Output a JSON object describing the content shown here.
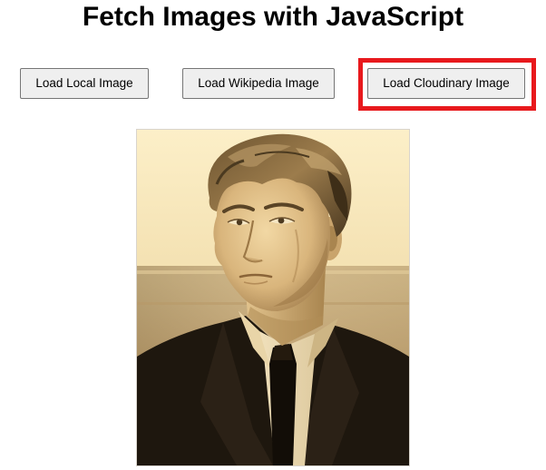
{
  "page": {
    "title": "Fetch Images with JavaScript"
  },
  "buttons": {
    "local": "Load Local Image",
    "wikipedia": "Load Wikipedia Image",
    "cloudinary": "Load Cloudinary Image"
  },
  "image": {
    "tone": "sepia"
  },
  "colors": {
    "highlight": "#e8191d",
    "button_bg": "#efefef",
    "button_border": "#767676"
  }
}
